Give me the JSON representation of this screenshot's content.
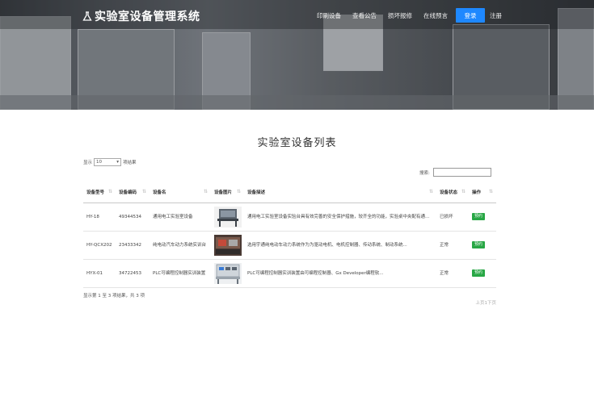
{
  "header": {
    "logo_text": "实验室设备管理系统",
    "nav": [
      "印刷设备",
      "查看公告",
      "损坏报修",
      "在线预言"
    ],
    "login_label": "登录",
    "register_label": "注册"
  },
  "main": {
    "title": "实验室设备列表",
    "length": {
      "prefix": "显示",
      "value": "10",
      "suffix": "项结果"
    },
    "search": {
      "label": "搜索:",
      "value": ""
    },
    "columns": [
      "设备型号",
      "设备编码",
      "设备名",
      "设备图片",
      "设备描述",
      "设备状态",
      "操作"
    ],
    "rows": [
      {
        "model": "HY-18",
        "code": "49344534",
        "name": "通用电工实验室设备",
        "image_icon": "equipment-thumbnail-icon",
        "desc": "通用电工实验室设备实验台具有效完善的安全保护措施，较齐全的功能，实验桌中央配有通...",
        "status": "已损坏",
        "action": "预约"
      },
      {
        "model": "HY-QCX202",
        "code": "23433342",
        "name": "纯电动汽车动力系统实训台",
        "image_icon": "equipment-thumbnail-icon",
        "desc": "选用宇通纯电动车动力系统作为为驱动电机、电机控制器、传动系统、制动系统...",
        "status": "正常",
        "action": "预约"
      },
      {
        "model": "HYX-01",
        "code": "34722453",
        "name": "PLC可编程控制器实训装置",
        "image_icon": "equipment-thumbnail-icon",
        "desc": "PLC可编程控制器实训装置由可编程控制器、Gx Developer编程软...",
        "status": "正常",
        "action": "预约"
      }
    ],
    "info": "显示第 1 至 3 项结果，共 3 项",
    "pager": "上页1下页"
  },
  "colors": {
    "accent": "#1e88ff",
    "ok": "#2e9e46",
    "bad": "#d9534f",
    "action": "#28a745"
  }
}
